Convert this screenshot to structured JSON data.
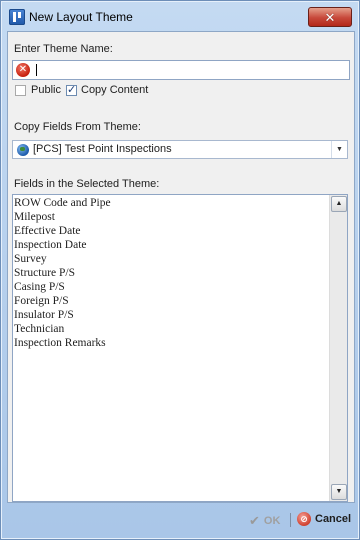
{
  "window": {
    "title": "New Layout Theme",
    "close_label": "✕"
  },
  "theme_name": {
    "label": "Enter Theme Name:",
    "value": "",
    "error_icon": "error-icon"
  },
  "options": {
    "public_label": "Public",
    "public_checked": false,
    "copy_content_label": "Copy Content",
    "copy_content_checked": true
  },
  "copy_from": {
    "label": "Copy Fields From Theme:",
    "selected": "[PCS] Test Point Inspections",
    "icon": "globe-icon"
  },
  "fields": {
    "label": "Fields in the Selected Theme:",
    "items": [
      "ROW Code and Pipe",
      "Milepost",
      "Effective Date",
      "Inspection Date",
      "Survey",
      "Structure P/S",
      "Casing P/S",
      "Foreign P/S",
      "Insulator P/S",
      "Technician",
      "Inspection Remarks"
    ]
  },
  "footer": {
    "ok_label": "OK",
    "ok_enabled": false,
    "cancel_label": "Cancel"
  }
}
